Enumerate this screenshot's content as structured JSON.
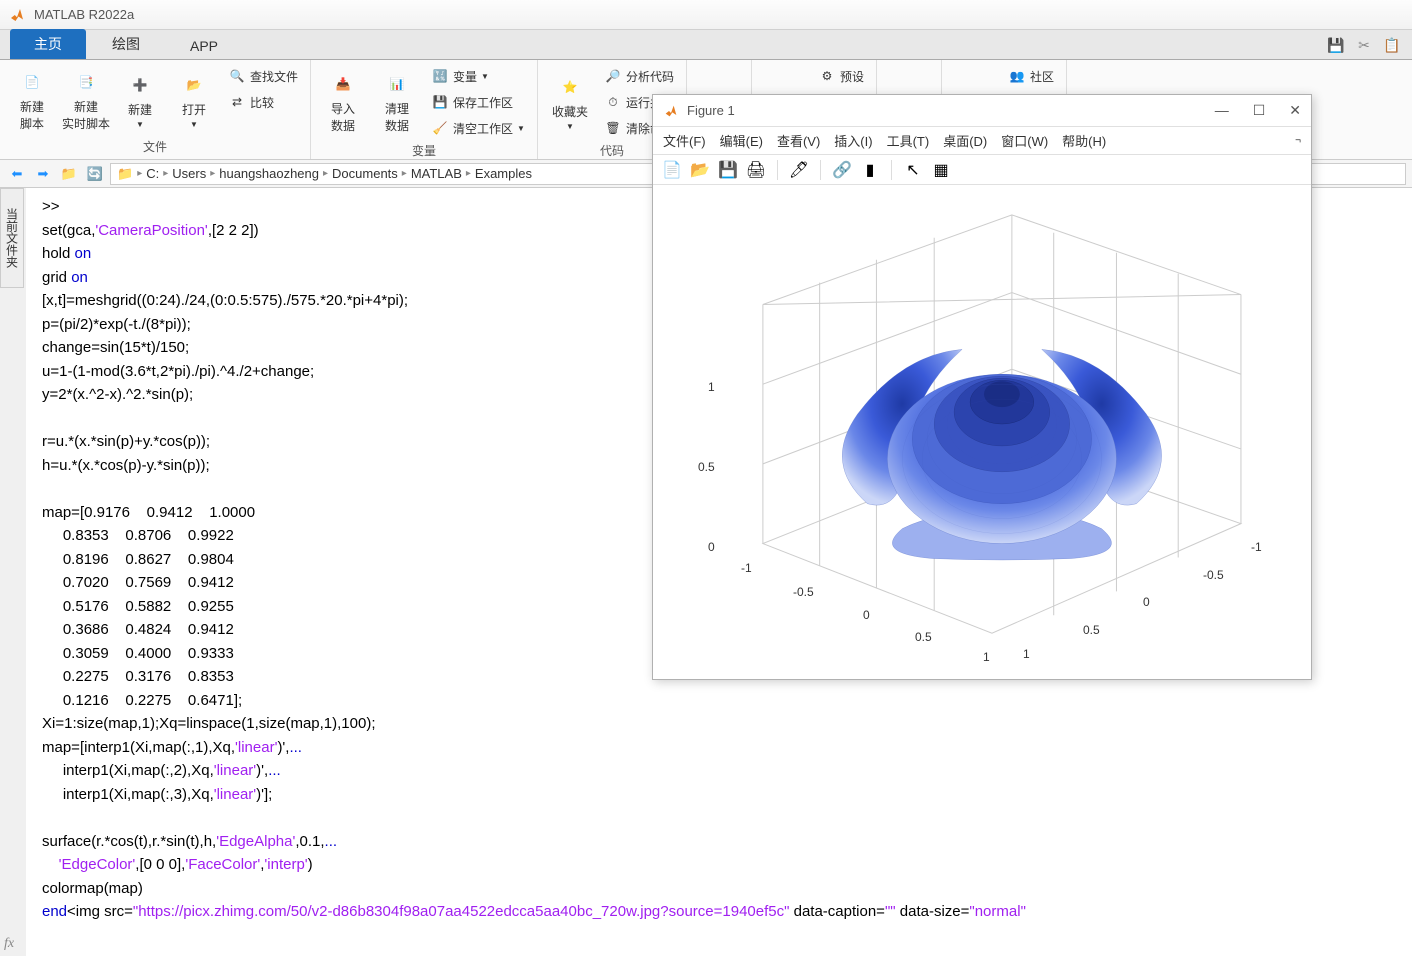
{
  "app_title": "MATLAB R2022a",
  "tabs": {
    "home": "主页",
    "plots": "绘图",
    "apps": "APP"
  },
  "ribbon": {
    "new_script": "新建\n脚本",
    "new_live": "新建\n实时脚本",
    "new": "新建",
    "open": "打开",
    "find_files": "查找文件",
    "compare": "比较",
    "group_file": "文件",
    "import": "导入\n数据",
    "clean": "清理\n数据",
    "var": "变量",
    "save_ws": "保存工作区",
    "clear_ws": "清空工作区",
    "group_var": "变量",
    "fav": "收藏夹",
    "analyze": "分析代码",
    "run_time": "运行并",
    "clear_cmd": "清除命",
    "group_code": "代码",
    "layout_icon": "",
    "prefs": "预设",
    "addons_icon": "",
    "help_icon": "",
    "community": "社区"
  },
  "path": {
    "drive": "C:",
    "p1": "Users",
    "p2": "huangshaozheng",
    "p3": "Documents",
    "p4": "MATLAB",
    "p5": "Examples"
  },
  "sidebar_label": "当前文件夹",
  "figure": {
    "title": "Figure 1",
    "menu": {
      "file": "文件(F)",
      "edit": "编辑(E)",
      "view": "查看(V)",
      "insert": "插入(I)",
      "tools": "工具(T)",
      "desktop": "桌面(D)",
      "window": "窗口(W)",
      "help": "帮助(H)"
    },
    "z_ticks": [
      "0",
      "0.5",
      "1"
    ],
    "x_ticks": [
      "-1",
      "-0.5",
      "0",
      "0.5",
      "1"
    ],
    "y_ticks": [
      "-1",
      "-0.5",
      "0",
      "0.5",
      "1"
    ]
  },
  "code": {
    "l1": ">>",
    "l2a": "set(gca,",
    "l2b": "'CameraPosition'",
    "l2c": ",[2 2 2])",
    "l3a": "hold ",
    "l3b": "on",
    "l4a": "grid ",
    "l4b": "on",
    "l5": "[x,t]=meshgrid((0:24)./24,(0:0.5:575)./575.*20.*pi+4*pi);",
    "l6": "p=(pi/2)*exp(-t./(8*pi));",
    "l7": "change=sin(15*t)/150;",
    "l8": "u=1-(1-mod(3.6*t,2*pi)./pi).^4./2+change;",
    "l9": "y=2*(x.^2-x).^2.*sin(p);",
    "l10": "",
    "l11": "r=u.*(x.*sin(p)+y.*cos(p));",
    "l12": "h=u.*(x.*cos(p)-y.*sin(p));",
    "l13": "",
    "l14": "map=[0.9176    0.9412    1.0000",
    "l15": "     0.8353    0.8706    0.9922",
    "l16": "     0.8196    0.8627    0.9804",
    "l17": "     0.7020    0.7569    0.9412",
    "l18": "     0.5176    0.5882    0.9255",
    "l19": "     0.3686    0.4824    0.9412",
    "l20": "     0.3059    0.4000    0.9333",
    "l21": "     0.2275    0.3176    0.8353",
    "l22": "     0.1216    0.2275    0.6471];",
    "l23": "Xi=1:size(map,1);Xq=linspace(1,size(map,1),100);",
    "l24a": "map=[interp1(Xi,map(:,1),Xq,",
    "l24b": "'linear'",
    "l24c": ")',",
    "l24d": "...",
    "l25a": "     interp1(Xi,map(:,2),Xq,",
    "l25b": "'linear'",
    "l25c": ")',",
    "l25d": "...",
    "l26a": "     interp1(Xi,map(:,3),Xq,",
    "l26b": "'linear'",
    "l26c": ")'];",
    "l27": "",
    "l28a": "surface(r.*cos(t),r.*sin(t),h,",
    "l28b": "'EdgeAlpha'",
    "l28c": ",0.1,",
    "l28d": "...",
    "l29a": "    ",
    "l29b": "'EdgeColor'",
    "l29c": ",[0 0 0],",
    "l29d": "'FaceColor'",
    "l29e": ",",
    "l29f": "'interp'",
    "l29g": ")",
    "l30": "colormap(map)",
    "l31a": "end",
    "l31b": "<img src=",
    "l31c": "\"https://picx.zhimg.com/50/v2-d86b8304f98a07aa4522edcca5aa40bc_720w.jpg?source=1940ef5c\"",
    "l31d": " data-caption=",
    "l31e": "\"\"",
    "l31f": " data-size=",
    "l31g": "\"normal\""
  },
  "chart_data": {
    "type": "surface3d",
    "title": "",
    "xlabel": "",
    "ylabel": "",
    "zlabel": "",
    "xlim": [
      -1,
      1
    ],
    "ylim": [
      -1,
      1
    ],
    "zlim": [
      0,
      1
    ],
    "xticks": [
      -1,
      -0.5,
      0,
      0.5,
      1
    ],
    "yticks": [
      -1,
      -0.5,
      0,
      0.5,
      1
    ],
    "zticks": [
      0,
      0.5,
      1
    ],
    "description": "3D rose-shaped parametric surface colored with blue interpolated colormap",
    "colormap": [
      [
        0.9176,
        0.9412,
        1.0
      ],
      [
        0.8353,
        0.8706,
        0.9922
      ],
      [
        0.8196,
        0.8627,
        0.9804
      ],
      [
        0.702,
        0.7569,
        0.9412
      ],
      [
        0.5176,
        0.5882,
        0.9255
      ],
      [
        0.3686,
        0.4824,
        0.9412
      ],
      [
        0.3059,
        0.4,
        0.9333
      ],
      [
        0.2275,
        0.3176,
        0.8353
      ],
      [
        0.1216,
        0.2275,
        0.6471
      ]
    ]
  }
}
